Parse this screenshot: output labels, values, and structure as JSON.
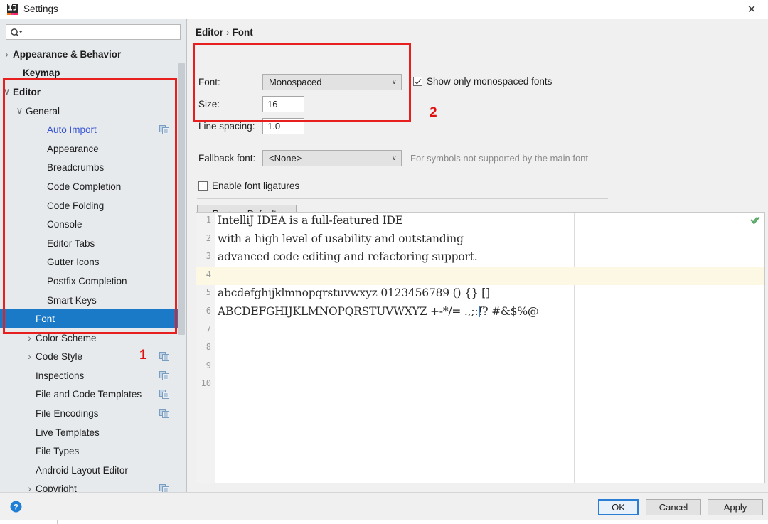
{
  "window": {
    "title": "Settings",
    "close_label": "✕",
    "app_icon": "intellij-idea-icon"
  },
  "sidebar": {
    "search": {
      "placeholder": "",
      "value": "",
      "icon": "search-icon"
    },
    "items": [
      {
        "label": "Appearance & Behavior",
        "indent": 18,
        "twisty": "›",
        "bold": true,
        "selected": false,
        "copy": false,
        "link": false
      },
      {
        "label": "Keymap",
        "indent": 32,
        "twisty": "",
        "bold": true,
        "selected": false,
        "copy": false,
        "link": false
      },
      {
        "label": "Editor",
        "indent": 18,
        "twisty": "∨",
        "bold": true,
        "selected": false,
        "copy": false,
        "link": false
      },
      {
        "label": "General",
        "indent": 36,
        "twisty": "∨",
        "bold": false,
        "selected": false,
        "copy": false,
        "link": false
      },
      {
        "label": "Auto Import",
        "indent": 66,
        "twisty": "",
        "bold": false,
        "selected": false,
        "copy": true,
        "link": true
      },
      {
        "label": "Appearance",
        "indent": 66,
        "twisty": "",
        "bold": false,
        "selected": false,
        "copy": false,
        "link": false
      },
      {
        "label": "Breadcrumbs",
        "indent": 66,
        "twisty": "",
        "bold": false,
        "selected": false,
        "copy": false,
        "link": false
      },
      {
        "label": "Code Completion",
        "indent": 66,
        "twisty": "",
        "bold": false,
        "selected": false,
        "copy": false,
        "link": false
      },
      {
        "label": "Code Folding",
        "indent": 66,
        "twisty": "",
        "bold": false,
        "selected": false,
        "copy": false,
        "link": false
      },
      {
        "label": "Console",
        "indent": 66,
        "twisty": "",
        "bold": false,
        "selected": false,
        "copy": false,
        "link": false
      },
      {
        "label": "Editor Tabs",
        "indent": 66,
        "twisty": "",
        "bold": false,
        "selected": false,
        "copy": false,
        "link": false
      },
      {
        "label": "Gutter Icons",
        "indent": 66,
        "twisty": "",
        "bold": false,
        "selected": false,
        "copy": false,
        "link": false
      },
      {
        "label": "Postfix Completion",
        "indent": 66,
        "twisty": "",
        "bold": false,
        "selected": false,
        "copy": false,
        "link": false
      },
      {
        "label": "Smart Keys",
        "indent": 66,
        "twisty": "",
        "bold": false,
        "selected": false,
        "copy": false,
        "link": false
      },
      {
        "label": "Font",
        "indent": 50,
        "twisty": "",
        "bold": false,
        "selected": true,
        "copy": false,
        "link": false
      },
      {
        "label": "Color Scheme",
        "indent": 50,
        "twisty": "›",
        "bold": false,
        "selected": false,
        "copy": false,
        "link": false
      },
      {
        "label": "Code Style",
        "indent": 50,
        "twisty": "›",
        "bold": false,
        "selected": false,
        "copy": true,
        "link": false
      },
      {
        "label": "Inspections",
        "indent": 50,
        "twisty": "",
        "bold": false,
        "selected": false,
        "copy": true,
        "link": false
      },
      {
        "label": "File and Code Templates",
        "indent": 50,
        "twisty": "",
        "bold": false,
        "selected": false,
        "copy": true,
        "link": false
      },
      {
        "label": "File Encodings",
        "indent": 50,
        "twisty": "",
        "bold": false,
        "selected": false,
        "copy": true,
        "link": false
      },
      {
        "label": "Live Templates",
        "indent": 50,
        "twisty": "",
        "bold": false,
        "selected": false,
        "copy": false,
        "link": false
      },
      {
        "label": "File Types",
        "indent": 50,
        "twisty": "",
        "bold": false,
        "selected": false,
        "copy": false,
        "link": false
      },
      {
        "label": "Android Layout Editor",
        "indent": 50,
        "twisty": "",
        "bold": false,
        "selected": false,
        "copy": false,
        "link": false
      },
      {
        "label": "Copyright",
        "indent": 50,
        "twisty": "›",
        "bold": false,
        "selected": false,
        "copy": true,
        "link": false
      }
    ]
  },
  "main": {
    "breadcrumb": {
      "parent": "Editor",
      "separator": "›",
      "current": "Font"
    },
    "font": {
      "label": "Font:",
      "value": "Monospaced",
      "arrow": "∨"
    },
    "size": {
      "label": "Size:",
      "value": "16"
    },
    "line_spacing": {
      "label": "Line spacing:",
      "value": "1.0"
    },
    "show_monospaced": {
      "label": "Show only monospaced fonts",
      "checked": true
    },
    "fallback_font": {
      "label": "Fallback font:",
      "value": "<None>",
      "arrow": "∨",
      "hint": "For symbols not supported by the main font"
    },
    "ligatures": {
      "label": "Enable font ligatures",
      "checked": false
    },
    "restore_defaults_label": "Restore Defaults"
  },
  "preview": {
    "status_icon": "green-double-check-icon",
    "lines": [
      {
        "num": "1",
        "text": "IntelliJ IDEA is a full-featured IDE",
        "highlight": false
      },
      {
        "num": "2",
        "text": "with a high level of usability and outstanding",
        "highlight": false
      },
      {
        "num": "3",
        "text": "advanced code editing and refactoring support.",
        "highlight": false
      },
      {
        "num": "4",
        "text": "",
        "highlight": true
      },
      {
        "num": "5",
        "text": "abcdefghijklmnopqrstuvwxyz 0123456789 () {} []",
        "highlight": false
      },
      {
        "num": "6",
        "text": "ABCDEFGHIJKLMNOPQRSTUVWXYZ +-*/= .,;:!? #&$%@",
        "highlight": false
      },
      {
        "num": "7",
        "text": "",
        "highlight": false
      },
      {
        "num": "8",
        "text": "",
        "highlight": false
      },
      {
        "num": "9",
        "text": "",
        "highlight": false
      },
      {
        "num": "10",
        "text": "",
        "highlight": false
      }
    ],
    "trailing_caret_line": "6",
    "trailing_caret_suffix": "ˆ"
  },
  "bottom": {
    "help_icon": "help-question-icon",
    "ok": "OK",
    "cancel": "Cancel",
    "apply": "Apply"
  },
  "annotations": [
    {
      "name": "1",
      "label": "1"
    },
    {
      "name": "2",
      "label": "2"
    }
  ],
  "colors": {
    "selection": "#1a7ac7",
    "annotation_red": "#e81f1f",
    "link_blue": "#3a56d4",
    "highlight_line": "#fdf8e4"
  }
}
